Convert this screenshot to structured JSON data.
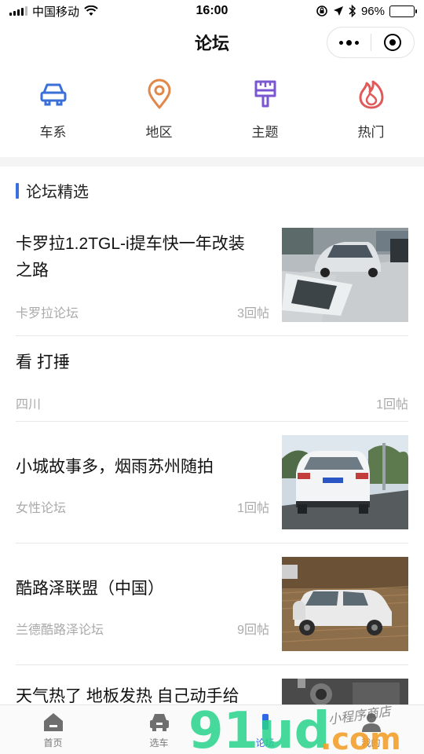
{
  "status_bar": {
    "carrier": "中国移动",
    "time": "16:00",
    "battery_percent": "96%",
    "battery_level": 0.96,
    "battery_color": "#4cd964"
  },
  "nav": {
    "title": "论坛",
    "menu_icon": "more-dots-icon",
    "close_icon": "target-circle-icon"
  },
  "categories": [
    {
      "label": "车系",
      "icon": "car-icon",
      "color": "#3a6fd8"
    },
    {
      "label": "地区",
      "icon": "location-pin-icon",
      "color": "#e0884a"
    },
    {
      "label": "主题",
      "icon": "brush-icon",
      "color": "#7a57d1"
    },
    {
      "label": "热门",
      "icon": "flame-icon",
      "color": "#e05a5a"
    }
  ],
  "section": {
    "title": "论坛精选",
    "accent": "#3a6fe0"
  },
  "posts": [
    {
      "title": "卡罗拉1.2TGL-i提车快一年改装之路",
      "title_line1": "卡罗拉1.2TGL-i提车快一年改装",
      "title_line2": "之路",
      "source": "卡罗拉论坛",
      "count": "3回帖",
      "has_image": true
    },
    {
      "title": "看 打捶",
      "source": "四川",
      "count": "1回帖",
      "has_image": false
    },
    {
      "title": "小城故事多，烟雨苏州随拍",
      "source": "女性论坛",
      "count": "1回帖",
      "has_image": true
    },
    {
      "title": "酷路泽联盟（中国）",
      "source": "兰德酷路泽论坛",
      "count": "9回帖",
      "has_image": true
    },
    {
      "title": "天气热了 地板发热 自己动手给",
      "source": "",
      "count": "",
      "has_image": true
    }
  ],
  "tabbar": [
    {
      "label": "首页",
      "icon": "home-icon",
      "active": false
    },
    {
      "label": "选车",
      "icon": "car-front-icon",
      "active": false
    },
    {
      "label": "论坛",
      "icon": "forum-icon",
      "active": true
    },
    {
      "label": "我的",
      "icon": "profile-icon",
      "active": false
    }
  ],
  "watermark": {
    "logo_text": "91ud",
    "suffix": ".com",
    "script": "小程序商店"
  }
}
